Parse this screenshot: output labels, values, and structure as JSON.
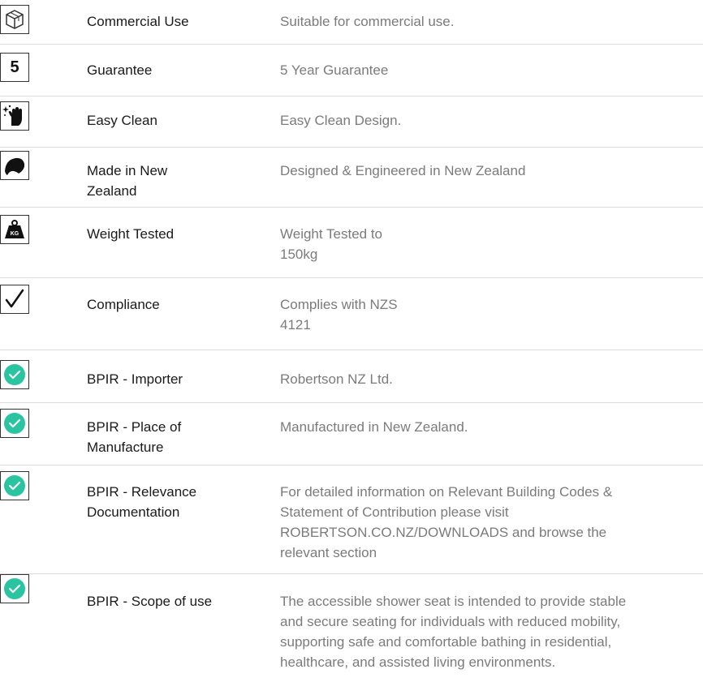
{
  "colors": {
    "check_green": "#2bc4a0",
    "label_text": "#1a1a1a",
    "value_text": "#7b7b7b",
    "divider": "#dcdcdc"
  },
  "features": [
    {
      "icon": "cube-icon",
      "label": "Commercial Use",
      "value": "Suitable for commercial use."
    },
    {
      "icon": "number-five-icon",
      "icon_text": "5",
      "label": "Guarantee",
      "value": "5 Year Guarantee"
    },
    {
      "icon": "wiping-hand-icon",
      "label": "Easy Clean",
      "value": "Easy Clean Design."
    },
    {
      "icon": "kiwi-icon",
      "label": "Made in New\nZealand",
      "value": "Designed & Engineered in New Zealand"
    },
    {
      "icon": "kg-weight-icon",
      "icon_text": "KG",
      "label": "Weight Tested",
      "value": "Weight Tested to\n150kg"
    },
    {
      "icon": "checkmark-icon",
      "label": "Compliance",
      "value": "Complies with NZS\n4121"
    },
    {
      "icon": "green-check-circle-icon",
      "label": "BPIR - Importer",
      "value": "Robertson NZ Ltd."
    },
    {
      "icon": "green-check-circle-icon",
      "label": "BPIR - Place of\nManufacture",
      "value": "Manufactured in New Zealand."
    },
    {
      "icon": "green-check-circle-icon",
      "label": "BPIR - Relevance\nDocumentation",
      "value": "For detailed information on Relevant Building Codes &\nStatement of Contribution please visit\nROBERTSON.CO.NZ/DOWNLOADS and browse the\nrelevant section"
    },
    {
      "icon": "green-check-circle-icon",
      "label": "BPIR - Scope of use",
      "value": "The accessible shower seat is intended to provide stable\nand secure seating for individuals with reduced mobility,\nsupporting safe and comfortable bathing in residential,\nhealthcare, and assisted living environments."
    }
  ]
}
